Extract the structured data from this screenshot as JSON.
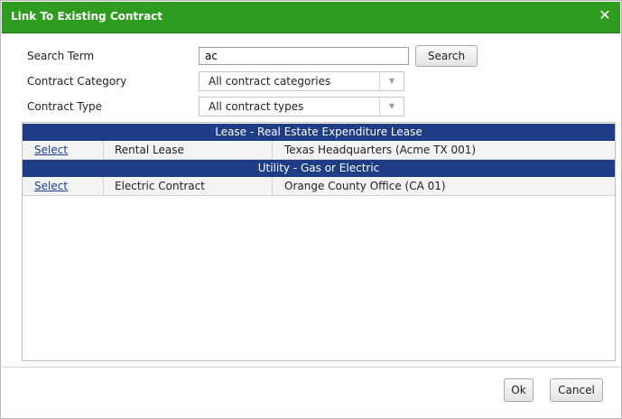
{
  "dialog": {
    "title": "Link To Existing Contract",
    "close_glyph": "✕"
  },
  "form": {
    "search_term_label": "Search Term",
    "search_term_value": "ac",
    "search_button": "Search",
    "category_label": "Contract Category",
    "category_value": "All contract categories",
    "type_label": "Contract Type",
    "type_value": "All contract types"
  },
  "results": {
    "groups": [
      {
        "header": "Lease - Real Estate Expenditure Lease",
        "rows": [
          {
            "action": "Select",
            "contract": "Rental Lease",
            "location": "Texas Headquarters (Acme TX 001)"
          }
        ]
      },
      {
        "header": "Utility - Gas or Electric",
        "rows": [
          {
            "action": "Select",
            "contract": "Electric Contract",
            "location": "Orange County Office (CA 01)"
          }
        ]
      }
    ]
  },
  "footer": {
    "ok": "Ok",
    "cancel": "Cancel"
  },
  "colors": {
    "title_bar": "#2e9c1f",
    "group_header": "#1f3d87",
    "link": "#1a3c9c"
  }
}
